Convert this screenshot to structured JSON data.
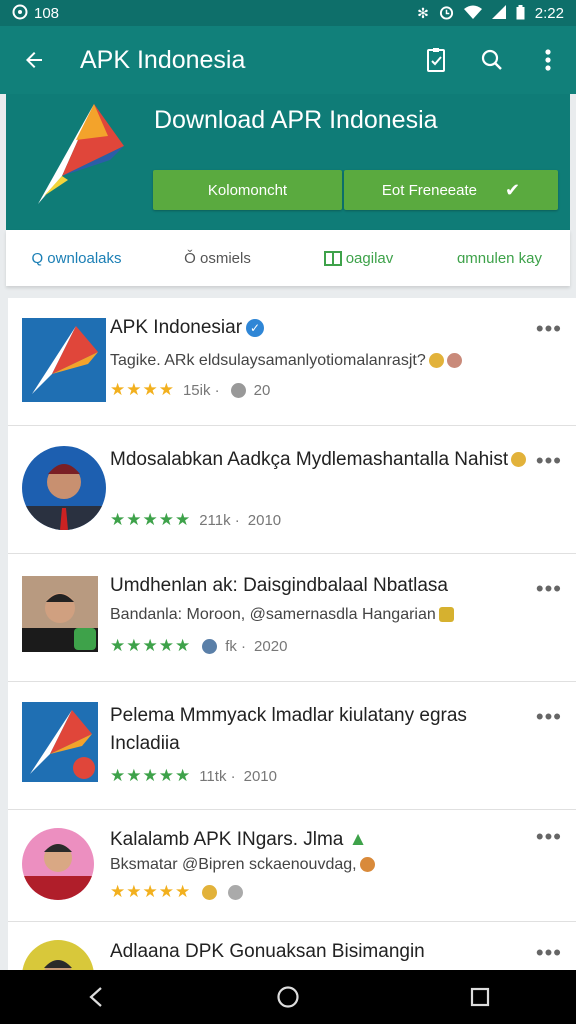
{
  "status_bar": {
    "left_text": "108",
    "time": "2:22"
  },
  "app_bar": {
    "title": "APK Indonesia",
    "icons": [
      "back-arrow-icon",
      "clipboard-check-icon",
      "search-icon",
      "more-vert-icon"
    ]
  },
  "hero": {
    "title": "Download APR Indonesia",
    "button1_label": "Kolomoncht",
    "button2_label": "Eot Freneeate"
  },
  "tabs": [
    {
      "label": "Q ownloalaks"
    },
    {
      "label": "Ǒ osmiels"
    },
    {
      "label": "oagilav"
    },
    {
      "label": "ɑmnulen kay"
    }
  ],
  "colors": {
    "primary": "#11807a",
    "accent_green": "#5aaa3f",
    "star_gold": "#f2b01e",
    "star_green": "#3ea24a"
  },
  "items": [
    {
      "title": "APK Indonesiar",
      "subtitle": "Tagike. ARk eldsulaysamanlyotiomalanrasjt?",
      "stars": "★★★★",
      "count": "15ik ·",
      "extra": "20"
    },
    {
      "title": "Mdosalabkan Aadkça Mydlemashantalla Nahist",
      "subtitle": "",
      "stars": "★★★★★",
      "count": "211k ·",
      "extra": "2010"
    },
    {
      "title": "Umdhenlan ak: Daisgindbalaal Nbatlasa",
      "subtitle": "Bandanla: Moroon, @samernasdla Hangarian",
      "stars": "★★★★★",
      "count": "fk ·",
      "extra": "2020"
    },
    {
      "title": "Pelema Mmmyack lmadlar kiulatany egras Incladiia",
      "subtitle": "",
      "stars": "★★★★★",
      "count": "11tk ·",
      "extra": "2010"
    },
    {
      "title": "Kalalamb APK INgars. Jlma",
      "subtitle": "Bksmatar @Bipren sckaenouvdag,",
      "stars": "★★★★★",
      "count": "",
      "extra": ""
    },
    {
      "title": "Adlaana DPK Gonuaksan Bisimangin",
      "subtitle": "",
      "stars": "",
      "count": "",
      "extra": ""
    }
  ]
}
